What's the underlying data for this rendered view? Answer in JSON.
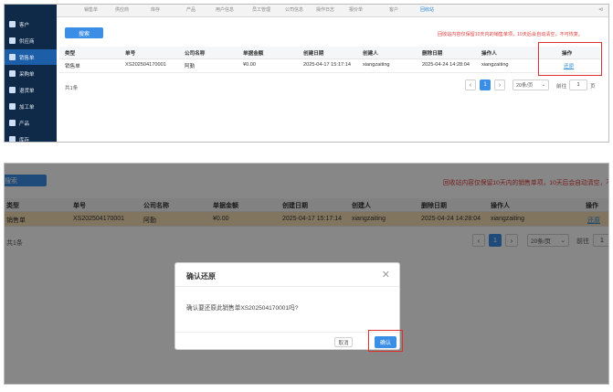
{
  "sidebar": {
    "items": [
      "客户",
      "供应商",
      "销售单",
      "采购单",
      "退货单",
      "加工单",
      "产品",
      "库存"
    ]
  },
  "tabs": [
    "销售单",
    "供应商",
    "库存",
    "产品",
    "用户信息",
    "员工管理",
    "公司信息",
    "操作日志",
    "报价单",
    "客户",
    "回收站"
  ],
  "search_button": "搜索",
  "notice": "回收站内容仅保留10天内的销售单项，10天后会自动清空，不可恢复。",
  "table": {
    "columns": [
      "类型",
      "单号",
      "公司名称",
      "单据金额",
      "创建日期",
      "创建人",
      "删除日期",
      "操作人",
      "操作"
    ],
    "rows": [
      {
        "type": "销售单",
        "order_no": "XS202504170001",
        "company": "阿勤",
        "amount": "¥0.00",
        "created": "2025-04-17 15:17:14",
        "creator": "xiangzaiting",
        "deleted": "2025-04-24 14:28:04",
        "operator": "xiangzaiting",
        "action": "还原"
      }
    ]
  },
  "pagination": {
    "total": "共1条",
    "current_page": "1",
    "page_size": "20条/页",
    "goto_label": "前往",
    "goto_value": "1",
    "page_suffix": "页"
  },
  "dialog": {
    "title": "确认还原",
    "message": "确认要还原此销售单XS202504170001吗?",
    "cancel": "取消",
    "confirm": "确认"
  },
  "colors": {
    "sidebar": "#0f2948",
    "active": "#1d5ea8",
    "primary": "#3a8ee6",
    "notice": "#e03a3a",
    "highlight": "#e0302e",
    "selected_row": "#f5deb3"
  }
}
